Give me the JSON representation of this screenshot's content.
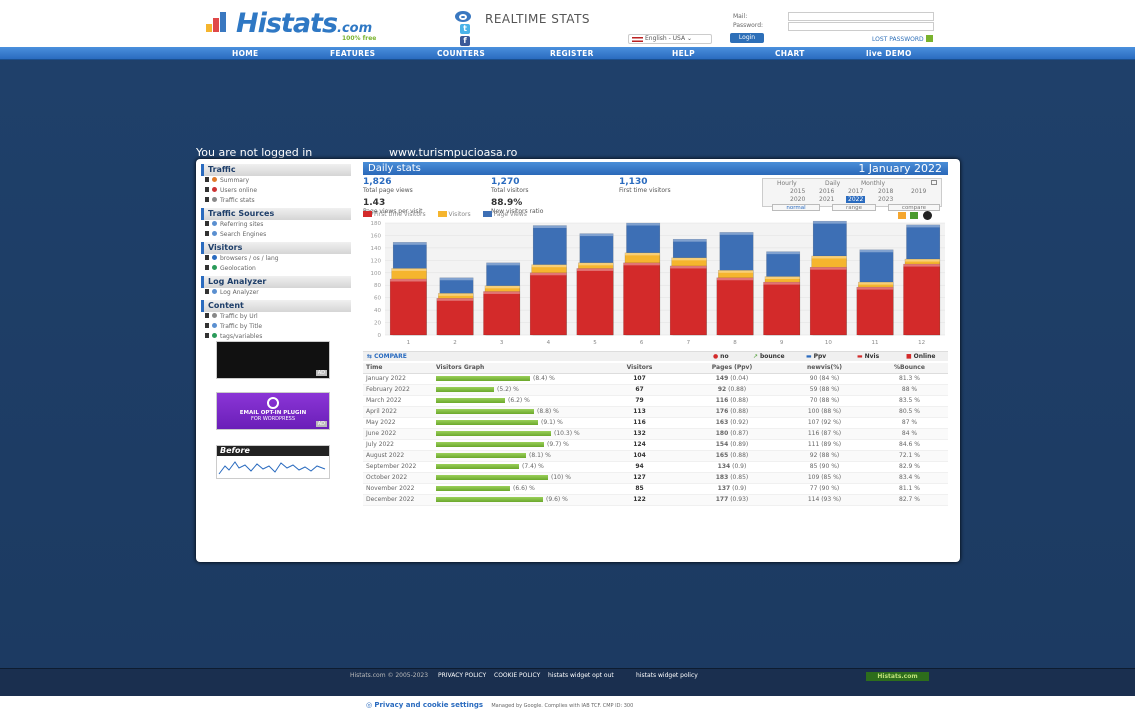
{
  "header": {
    "logo_text": "Histats",
    "logo_com": ".com",
    "logo_free": "100% free",
    "realtime": "REALTIME STATS",
    "language": "English - USA",
    "mail_label": "Mail:",
    "password_label": "Password:",
    "login_btn": "Login",
    "lost_password": "LOST PASSWORD"
  },
  "nav": [
    "HOME",
    "FEATURES",
    "COUNTERS",
    "REGISTER",
    "HELP",
    "CHART",
    "live DEMO"
  ],
  "status": {
    "not_logged": "You are not logged in",
    "site": "www.turismpucioasa.ro"
  },
  "sidebar": {
    "sections": [
      {
        "title": "Traffic",
        "items": [
          "Summary",
          "Users online",
          "Traffic stats"
        ]
      },
      {
        "title": "Traffic Sources",
        "items": [
          "Referring sites",
          "Search Engines"
        ]
      },
      {
        "title": "Visitors",
        "items": [
          "browsers / os / lang",
          "Geolocation"
        ]
      },
      {
        "title": "Log Analyzer",
        "items": [
          "Log Analyzer"
        ]
      },
      {
        "title": "Content",
        "items": [
          "Traffic by Url",
          "Traffic by Title",
          "tags/variables"
        ]
      }
    ],
    "ads": {
      "ad_label": "AD",
      "plugin_title": "EMAIL OPT-IN PLUGIN",
      "plugin_sub": "FOR WORDPRESS",
      "before": "Before"
    }
  },
  "main": {
    "title": "Daily stats",
    "date": "1 January 2022",
    "kpis": [
      {
        "value": "1,826",
        "label": "Total page views"
      },
      {
        "value": "1,270",
        "label": "Total visitors"
      },
      {
        "value": "1,130",
        "label": "First time visitors"
      },
      {
        "value": "1.43",
        "label": "Page views per visit"
      },
      {
        "value": "88.9%",
        "label": "New visitors ratio"
      }
    ],
    "periods": {
      "tabs": [
        "Hourly",
        "Daily",
        "Monthly"
      ],
      "years": [
        "2015",
        "2016",
        "2017",
        "2018",
        "2019",
        "2020",
        "2021",
        "2022",
        "2023"
      ],
      "selected": "2022"
    },
    "modes": [
      "normal",
      "range",
      "compare"
    ],
    "legend": [
      "First time visitors",
      "Visitors",
      "Page views"
    ],
    "toolbar": {
      "compare": "COMPARE",
      "no": "no",
      "bounce": "bounce",
      "ppv": "Ppv",
      "nvis": "Nvis",
      "online": "Online"
    }
  },
  "chart_data": {
    "type": "bar",
    "categories": [
      "1",
      "2",
      "3",
      "4",
      "5",
      "6",
      "7",
      "8",
      "9",
      "10",
      "11",
      "12"
    ],
    "series": [
      {
        "name": "First time visitors",
        "values": [
          90,
          59,
          70,
          100,
          107,
          116,
          111,
          92,
          85,
          109,
          77,
          114
        ]
      },
      {
        "name": "Visitors",
        "values": [
          107,
          67,
          79,
          113,
          116,
          132,
          124,
          104,
          94,
          127,
          85,
          122
        ]
      },
      {
        "name": "Page views",
        "values": [
          149,
          92,
          116,
          176,
          163,
          180,
          154,
          165,
          134,
          183,
          137,
          177
        ]
      }
    ],
    "yticks": [
      "0",
      "20",
      "40",
      "60",
      "80",
      "100",
      "120",
      "140",
      "160",
      "180"
    ],
    "ylim": [
      0,
      180
    ],
    "colors": [
      "#d32a2a",
      "#f5b52e",
      "#3d6fb5"
    ]
  },
  "table": {
    "headers": [
      "Time",
      "Visitors Graph",
      "Visitors",
      "Pages (Ppv)",
      "newvis(%)",
      "%Bounce"
    ],
    "rows": [
      {
        "time": "January 2022",
        "pct": "(8.4) %",
        "share": 8.4,
        "visitors": "107",
        "pages": "149",
        "ppv": "(0.04)",
        "newvis": "90 (84 %)",
        "bounce": "81.3 %"
      },
      {
        "time": "February 2022",
        "pct": "(5.2) %",
        "share": 5.2,
        "visitors": "67",
        "pages": "92",
        "ppv": "(0.88)",
        "newvis": "59 (88 %)",
        "bounce": "88 %"
      },
      {
        "time": "March 2022",
        "pct": "(6.2) %",
        "share": 6.2,
        "visitors": "79",
        "pages": "116",
        "ppv": "(0.88)",
        "newvis": "70 (88 %)",
        "bounce": "83.5 %"
      },
      {
        "time": "April 2022",
        "pct": "(8.8) %",
        "share": 8.8,
        "visitors": "113",
        "pages": "176",
        "ppv": "(0.88)",
        "newvis": "100 (88 %)",
        "bounce": "80.5 %"
      },
      {
        "time": "May 2022",
        "pct": "(9.1) %",
        "share": 9.1,
        "visitors": "116",
        "pages": "163",
        "ppv": "(0.92)",
        "newvis": "107 (92 %)",
        "bounce": "87 %"
      },
      {
        "time": "June 2022",
        "pct": "(10.3) %",
        "share": 10.3,
        "visitors": "132",
        "pages": "180",
        "ppv": "(0.87)",
        "newvis": "116 (87 %)",
        "bounce": "84 %"
      },
      {
        "time": "July 2022",
        "pct": "(9.7) %",
        "share": 9.7,
        "visitors": "124",
        "pages": "154",
        "ppv": "(0.89)",
        "newvis": "111 (89 %)",
        "bounce": "84.6 %"
      },
      {
        "time": "August 2022",
        "pct": "(8.1) %",
        "share": 8.1,
        "visitors": "104",
        "pages": "165",
        "ppv": "(0.88)",
        "newvis": "92 (88 %)",
        "bounce": "72.1 %"
      },
      {
        "time": "September 2022",
        "pct": "(7.4) %",
        "share": 7.4,
        "visitors": "94",
        "pages": "134",
        "ppv": "(0.9)",
        "newvis": "85 (90 %)",
        "bounce": "82.9 %"
      },
      {
        "time": "October 2022",
        "pct": "(10) %",
        "share": 10,
        "visitors": "127",
        "pages": "183",
        "ppv": "(0.85)",
        "newvis": "109 (85 %)",
        "bounce": "83.4 %"
      },
      {
        "time": "November 2022",
        "pct": "(6.6) %",
        "share": 6.6,
        "visitors": "85",
        "pages": "137",
        "ppv": "(0.9)",
        "newvis": "77 (90 %)",
        "bounce": "81.1 %"
      },
      {
        "time": "December 2022",
        "pct": "(9.6) %",
        "share": 9.6,
        "visitors": "122",
        "pages": "177",
        "ppv": "(0.93)",
        "newvis": "114 (93 %)",
        "bounce": "82.7 %"
      }
    ]
  },
  "footer": {
    "copyright": "Histats.com © 2005-2023",
    "links": [
      "PRIVACY POLICY",
      "COOKIE POLICY",
      "histats widget opt out",
      "histats widget policy"
    ],
    "badge": "Histats.com",
    "privacy": "Privacy and cookie settings",
    "privacy_note": "Managed by Google. Complies with IAB TCF. CMP ID: 300"
  }
}
